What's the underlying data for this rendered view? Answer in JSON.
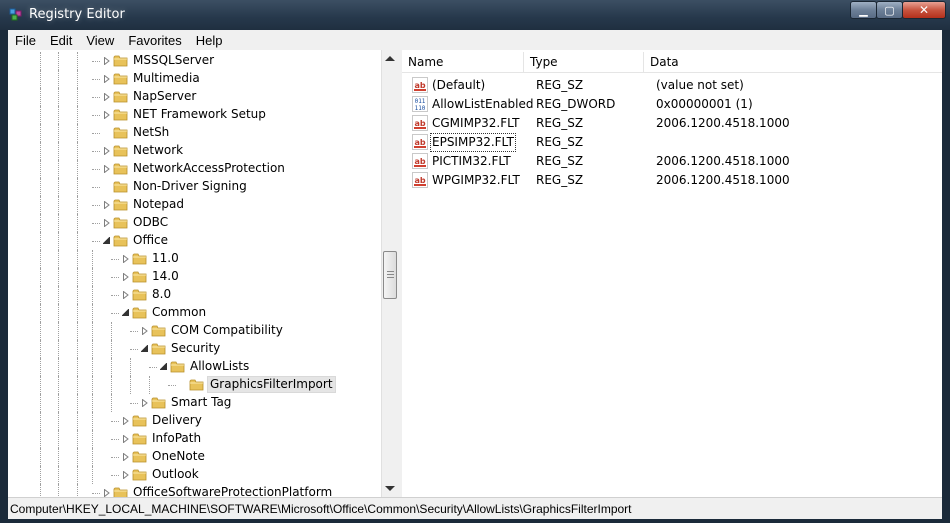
{
  "window": {
    "title": "Registry Editor"
  },
  "caption_buttons": {
    "minimize": "▁",
    "maximize": "▢",
    "close": "✕"
  },
  "menu": [
    "File",
    "Edit",
    "View",
    "Favorites",
    "Help"
  ],
  "tree": [
    {
      "label": "MSSQLServer",
      "depth": 0,
      "expander": "closed"
    },
    {
      "label": "Multimedia",
      "depth": 0,
      "expander": "closed"
    },
    {
      "label": "NapServer",
      "depth": 0,
      "expander": "closed"
    },
    {
      "label": "NET Framework Setup",
      "depth": 0,
      "expander": "closed"
    },
    {
      "label": "NetSh",
      "depth": 0,
      "expander": "none"
    },
    {
      "label": "Network",
      "depth": 0,
      "expander": "closed"
    },
    {
      "label": "NetworkAccessProtection",
      "depth": 0,
      "expander": "closed"
    },
    {
      "label": "Non-Driver Signing",
      "depth": 0,
      "expander": "none"
    },
    {
      "label": "Notepad",
      "depth": 0,
      "expander": "closed"
    },
    {
      "label": "ODBC",
      "depth": 0,
      "expander": "closed"
    },
    {
      "label": "Office",
      "depth": 0,
      "expander": "open"
    },
    {
      "label": "11.0",
      "depth": 1,
      "expander": "closed"
    },
    {
      "label": "14.0",
      "depth": 1,
      "expander": "closed"
    },
    {
      "label": "8.0",
      "depth": 1,
      "expander": "closed"
    },
    {
      "label": "Common",
      "depth": 1,
      "expander": "open"
    },
    {
      "label": "COM Compatibility",
      "depth": 2,
      "expander": "closed"
    },
    {
      "label": "Security",
      "depth": 2,
      "expander": "open"
    },
    {
      "label": "AllowLists",
      "depth": 3,
      "expander": "open"
    },
    {
      "label": "GraphicsFilterImport",
      "depth": 4,
      "expander": "none",
      "selected": true
    },
    {
      "label": "Smart Tag",
      "depth": 2,
      "expander": "closed"
    },
    {
      "label": "Delivery",
      "depth": 1,
      "expander": "closed"
    },
    {
      "label": "InfoPath",
      "depth": 1,
      "expander": "closed"
    },
    {
      "label": "OneNote",
      "depth": 1,
      "expander": "closed"
    },
    {
      "label": "Outlook",
      "depth": 1,
      "expander": "closed"
    },
    {
      "label": "OfficeSoftwareProtectionPlatform",
      "depth": 0,
      "expander": "closed"
    }
  ],
  "list": {
    "columns": [
      "Name",
      "Type",
      "Data"
    ],
    "rows": [
      {
        "icon": "string-value-icon",
        "name": "(Default)",
        "type": "REG_SZ",
        "data": "(value not set)"
      },
      {
        "icon": "binary-value-icon",
        "name": "AllowListEnabled",
        "type": "REG_DWORD",
        "data": "0x00000001 (1)"
      },
      {
        "icon": "string-value-icon",
        "name": "CGMIMP32.FLT",
        "type": "REG_SZ",
        "data": "2006.1200.4518.1000"
      },
      {
        "icon": "string-value-icon",
        "name": "EPSIMP32.FLT",
        "type": "REG_SZ",
        "data": "",
        "focused": true
      },
      {
        "icon": "string-value-icon",
        "name": "PICTIM32.FLT",
        "type": "REG_SZ",
        "data": "2006.1200.4518.1000"
      },
      {
        "icon": "string-value-icon",
        "name": "WPGIMP32.FLT",
        "type": "REG_SZ",
        "data": "2006.1200.4518.1000"
      }
    ]
  },
  "status": {
    "path": "Computer\\HKEY_LOCAL_MACHINE\\SOFTWARE\\Microsoft\\Office\\Common\\Security\\AllowLists\\GraphicsFilterImport"
  },
  "colors": {
    "folder": "#e8c25a",
    "selection": "#e5e5e5",
    "titlebar": "#26384b"
  }
}
